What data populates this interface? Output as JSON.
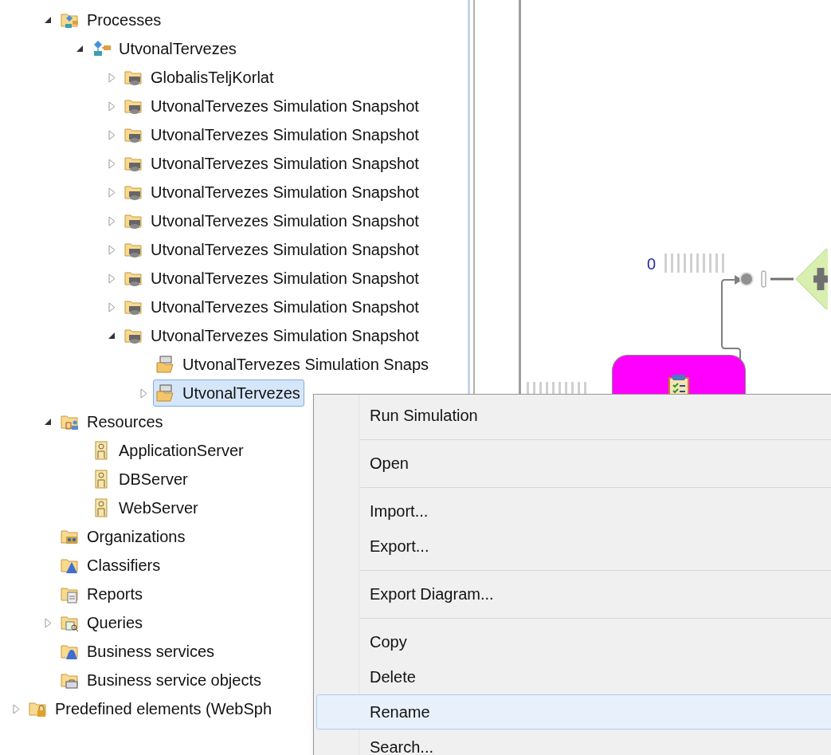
{
  "tree": {
    "items": [
      {
        "label": "Processes",
        "kind": "process-group",
        "expanded": true,
        "selected": false,
        "children": [
          {
            "label": "UtvonalTervezes",
            "kind": "process",
            "expanded": true,
            "selected": false,
            "children": [
              {
                "label": "GlobalisTeljKorlat",
                "kind": "snapshot-folder",
                "expanded": false,
                "selected": false
              },
              {
                "label": "UtvonalTervezes Simulation Snapshot",
                "kind": "snapshot-folder",
                "expanded": false,
                "selected": false
              },
              {
                "label": "UtvonalTervezes Simulation Snapshot",
                "kind": "snapshot-folder",
                "expanded": false,
                "selected": false
              },
              {
                "label": "UtvonalTervezes Simulation Snapshot",
                "kind": "snapshot-folder",
                "expanded": false,
                "selected": false
              },
              {
                "label": "UtvonalTervezes Simulation Snapshot",
                "kind": "snapshot-folder",
                "expanded": false,
                "selected": false
              },
              {
                "label": "UtvonalTervezes Simulation Snapshot",
                "kind": "snapshot-folder",
                "expanded": false,
                "selected": false
              },
              {
                "label": "UtvonalTervezes Simulation Snapshot",
                "kind": "snapshot-folder",
                "expanded": false,
                "selected": false
              },
              {
                "label": "UtvonalTervezes Simulation Snapshot",
                "kind": "snapshot-folder",
                "expanded": false,
                "selected": false
              },
              {
                "label": "UtvonalTervezes Simulation Snapshot",
                "kind": "snapshot-folder",
                "expanded": false,
                "selected": false
              },
              {
                "label": "UtvonalTervezes Simulation Snapshot",
                "kind": "snapshot-folder",
                "expanded": true,
                "selected": false,
                "children": [
                  {
                    "label": "UtvonalTervezes Simulation Snaps",
                    "kind": "snapshot",
                    "selected": false
                  },
                  {
                    "label": "UtvonalTervezes",
                    "kind": "snapshot",
                    "expanded": false,
                    "selected": true
                  }
                ]
              }
            ]
          }
        ]
      },
      {
        "label": "Resources",
        "kind": "resources-folder",
        "expanded": true,
        "selected": false,
        "children": [
          {
            "label": "ApplicationServer",
            "kind": "resource",
            "selected": false
          },
          {
            "label": "DBServer",
            "kind": "resource",
            "selected": false
          },
          {
            "label": "WebServer",
            "kind": "resource",
            "selected": false
          }
        ]
      },
      {
        "label": "Organizations",
        "kind": "org-folder",
        "selected": false
      },
      {
        "label": "Classifiers",
        "kind": "classifier-folder",
        "selected": false
      },
      {
        "label": "Reports",
        "kind": "report-folder",
        "selected": false
      },
      {
        "label": "Queries",
        "kind": "query-folder",
        "expanded": false,
        "selected": false
      },
      {
        "label": "Business services",
        "kind": "service-folder",
        "selected": false
      },
      {
        "label": "Business service objects",
        "kind": "service-object-folder",
        "selected": false
      }
    ],
    "root_items": [
      {
        "label": "Predefined elements (WebSph",
        "kind": "predefined-folder",
        "expanded": false,
        "selected": false
      }
    ]
  },
  "diagram": {
    "counter": "0"
  },
  "context_menu": [
    {
      "kind": "item",
      "label": "Run Simulation",
      "selected": false
    },
    {
      "kind": "separator"
    },
    {
      "kind": "item",
      "label": "Open",
      "selected": false
    },
    {
      "kind": "separator"
    },
    {
      "kind": "item",
      "label": "Import...",
      "selected": false
    },
    {
      "kind": "item",
      "label": "Export...",
      "selected": false
    },
    {
      "kind": "separator"
    },
    {
      "kind": "item",
      "label": "Export Diagram...",
      "selected": false
    },
    {
      "kind": "separator"
    },
    {
      "kind": "item",
      "label": "Copy",
      "selected": false
    },
    {
      "kind": "item",
      "label": "Delete",
      "selected": false
    },
    {
      "kind": "item",
      "label": "Rename",
      "selected": true
    },
    {
      "kind": "item",
      "label": "Search...",
      "selected": false
    }
  ]
}
